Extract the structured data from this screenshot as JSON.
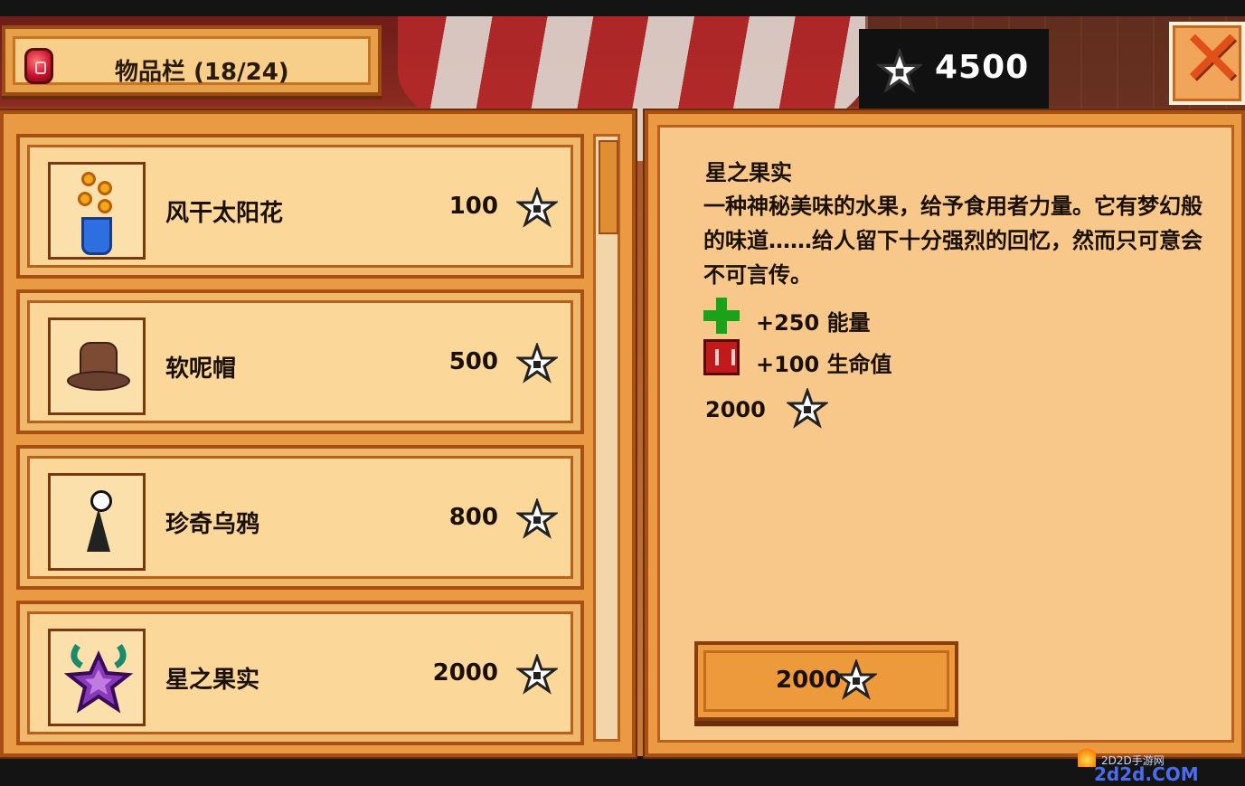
{
  "header": {
    "title": "物品栏 (18/24)",
    "currency": "4500"
  },
  "icons": {
    "inventory": "red-gem-icon",
    "currency": "star-coin-icon",
    "close": "close-x-icon",
    "energy": "green-plus-icon",
    "health": "red-health-icon"
  },
  "items": [
    {
      "name": "风干太阳花",
      "price": "100"
    },
    {
      "name": "软呢帽",
      "price": "500"
    },
    {
      "name": "珍奇乌鸦",
      "price": "800"
    },
    {
      "name": "星之果实",
      "price": "2000"
    }
  ],
  "detail": {
    "name": "星之果实",
    "description": "一种神秘美味的水果，给予食用者力量。它有梦幻般的味道……给人留下十分强烈的回忆，然而只可意会不可言传。",
    "stats": [
      {
        "label": "+250 能量"
      },
      {
        "label": "+100 生命值"
      }
    ],
    "price": "2000",
    "buy_label": "2000"
  },
  "scroll": {
    "position": 0.0
  },
  "watermark": {
    "label": "2D2D手游网",
    "url": "2d2d.COM"
  },
  "colors": {
    "panel": "#e99a43",
    "panel_border": "#a84f14",
    "item_bg": "#fbd89a",
    "energy": "#1aa21a",
    "health": "#c21a1a",
    "close": "#e2501a"
  }
}
